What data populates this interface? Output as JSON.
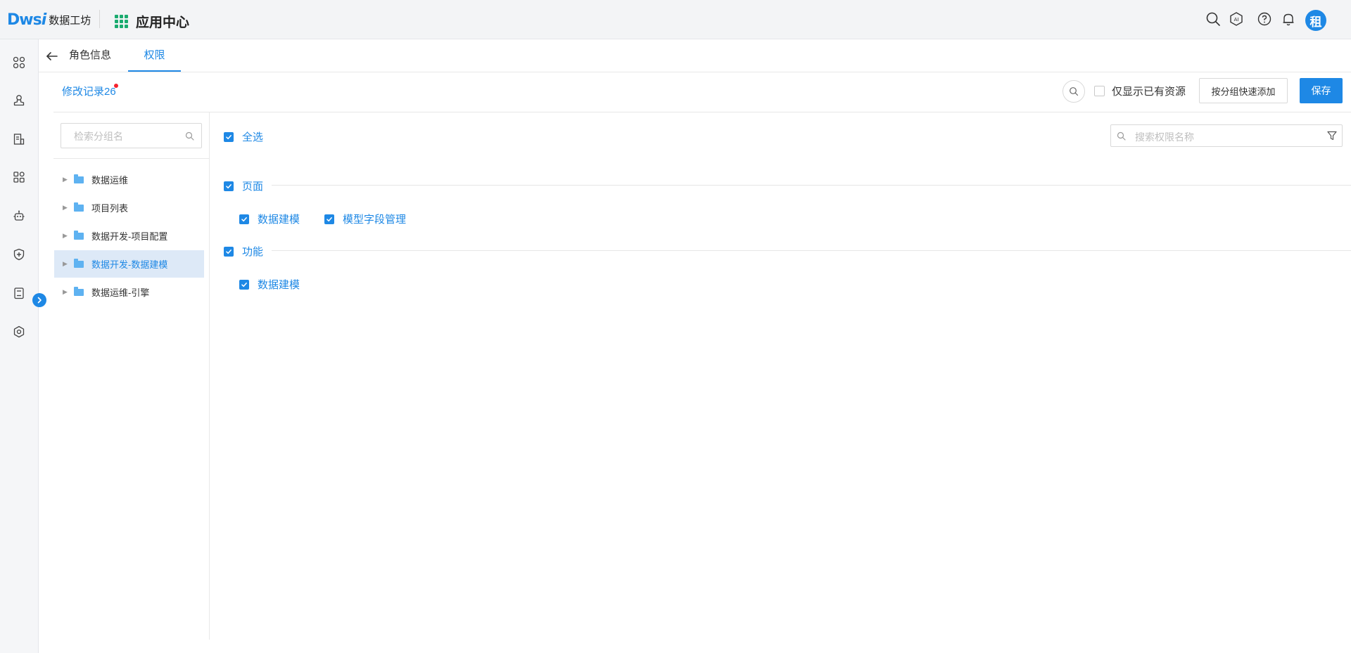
{
  "header": {
    "logo_mark": "Dws",
    "logo_mark_i": "i",
    "logo_text": "数据工坊",
    "app_center": "应用中心",
    "avatar": "租",
    "icons": [
      "search-icon",
      "ai-icon",
      "help-icon",
      "bell-icon"
    ]
  },
  "rail": {
    "icons": [
      "apps-icon",
      "user-stamp-icon",
      "document-chart-icon",
      "modules-icon",
      "robot-icon",
      "shield-plus-icon",
      "clipboard-icon",
      "settings-icon"
    ],
    "toggle": "›"
  },
  "tabs": [
    {
      "label": "角色信息"
    },
    {
      "label": "权限"
    }
  ],
  "toolbar": {
    "change_log": "修改记录26",
    "only_show_label": "仅显示已有资源",
    "group_add_label": "按分组快速添加",
    "save_label": "保存"
  },
  "group_panel": {
    "search_placeholder": "检索分组名",
    "items": [
      {
        "label": "数据运维",
        "active": false
      },
      {
        "label": "项目列表",
        "active": false
      },
      {
        "label": "数据开发-项目配置",
        "active": false
      },
      {
        "label": "数据开发-数据建模",
        "active": true
      },
      {
        "label": "数据运维-引擎",
        "active": false
      }
    ]
  },
  "permissions": {
    "select_all": "全选",
    "search_placeholder": "搜索权限名称",
    "sections": [
      {
        "title": "页面",
        "items": [
          "数据建模",
          "模型字段管理"
        ]
      },
      {
        "title": "功能",
        "items": [
          "数据建模"
        ]
      }
    ]
  },
  "colors": {
    "accent": "#1e88e5",
    "active_row_bg": "#dde9f7",
    "folder": "#5eb2f1",
    "app_grid": "#1aab6f"
  }
}
